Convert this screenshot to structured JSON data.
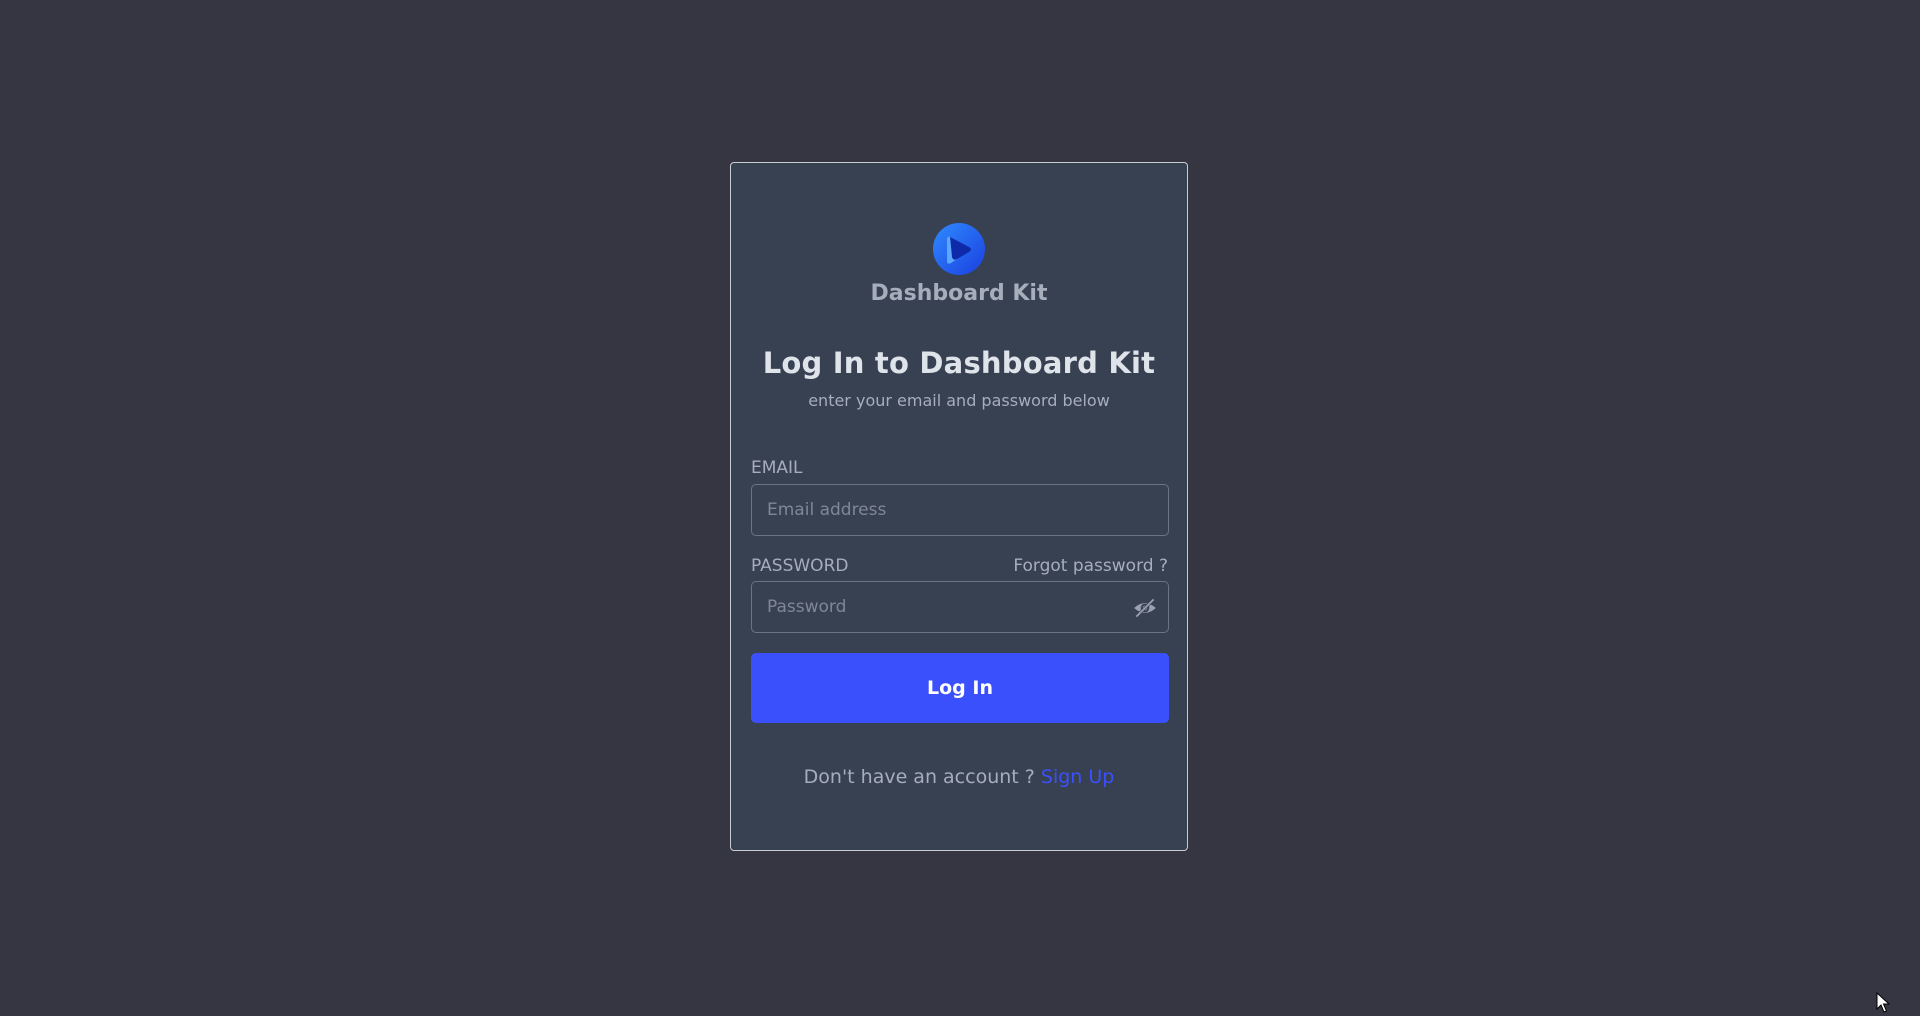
{
  "brand": {
    "name": "Dashboard Kit",
    "logo_icon": "dashboard-kit-logo-icon",
    "logo_color": "#1e6bff"
  },
  "header": {
    "title": "Log In to Dashboard Kit",
    "subtitle": "enter your email and password below"
  },
  "form": {
    "email": {
      "label": "EMAIL",
      "placeholder": "Email address",
      "value": ""
    },
    "password": {
      "label": "PASSWORD",
      "placeholder": "Password",
      "value": "",
      "toggle_icon": "eye-off-icon"
    },
    "forgot_label": "Forgot password ?",
    "submit_label": "Log In"
  },
  "footer": {
    "prompt": "Don't have an account ?",
    "signup_label": "Sign Up"
  },
  "colors": {
    "background": "#363642",
    "card": "#384152",
    "accent": "#3a50fc",
    "text_muted": "#a6adbb",
    "text_title": "#dfe3ea"
  }
}
